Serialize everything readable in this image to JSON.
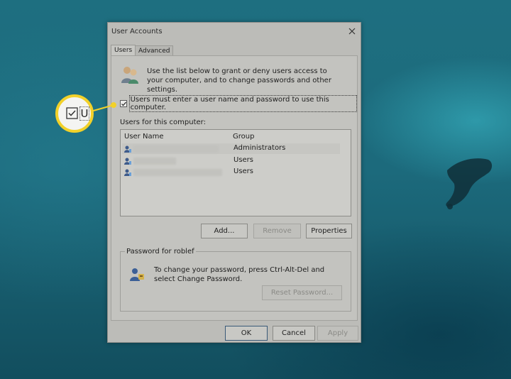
{
  "dialog": {
    "title": "User Accounts",
    "tabs": [
      {
        "label": "Users",
        "active": true
      },
      {
        "label": "Advanced",
        "active": false
      }
    ],
    "intro_text": "Use the list below to grant or deny users access to your computer, and to change passwords and other settings.",
    "require_login": {
      "checked": true,
      "label": "Users must enter a user name and password to use this computer."
    },
    "users_label": "Users for this computer:",
    "user_list": {
      "columns": [
        "User Name",
        "Group"
      ],
      "rows": [
        {
          "name": "",
          "group": "Administrators"
        },
        {
          "name": "",
          "group": "Users"
        },
        {
          "name": "",
          "group": "Users"
        }
      ]
    },
    "buttons": {
      "add": "Add...",
      "remove": "Remove",
      "properties": "Properties"
    },
    "password_group": {
      "title": "Password for roblef",
      "text": "To change your password, press Ctrl-Alt-Del and select Change Password.",
      "reset_button": "Reset Password..."
    },
    "footer": {
      "ok": "OK",
      "cancel": "Cancel",
      "apply": "Apply"
    }
  },
  "callout": {
    "letter": "U",
    "color": "#f2d12a"
  },
  "icons": [
    "close-icon",
    "users-icon",
    "user-icon",
    "password-keys-icon",
    "checkmark-icon"
  ]
}
